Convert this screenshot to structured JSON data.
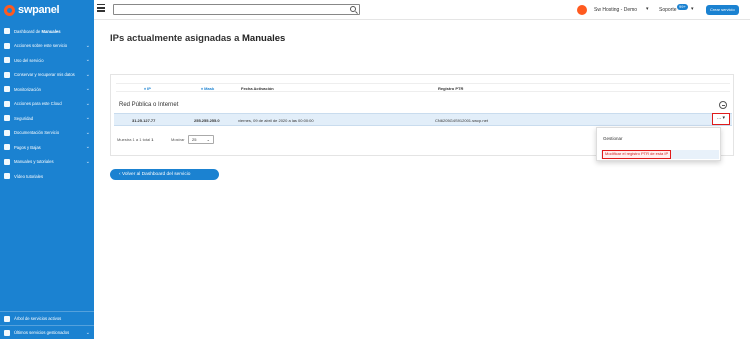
{
  "brand": {
    "logo_text": "swpanel",
    "accent": "#1b82d1",
    "logo_color": "#ff5a1f"
  },
  "sidebar": {
    "items": [
      {
        "label": "Dashboard de",
        "bold": "Manuales",
        "icon": "dashboard-icon"
      },
      {
        "label": "Acciones sobre este servicio",
        "icon": "gear-icon",
        "chevron": "⌄"
      },
      {
        "label": "Uso del servicio",
        "icon": "chart-icon",
        "chevron": "⌄"
      },
      {
        "label": "Conservar y recuperar mis datos",
        "icon": "backup-icon",
        "chevron": "⌄"
      },
      {
        "label": "Monitorización",
        "icon": "monitor-icon",
        "chevron": "⌄"
      },
      {
        "label": "Acciones para este Cloud",
        "icon": "cloud-icon",
        "chevron": "⌄"
      },
      {
        "label": "Seguridad",
        "icon": "shield-icon",
        "chevron": "⌄"
      },
      {
        "label": "Documentación Servicio",
        "icon": "document-icon",
        "chevron": "⌄"
      },
      {
        "label": "Pagos y Bajas",
        "icon": "wallet-icon",
        "chevron": "⌄"
      },
      {
        "label": "Manuales y tutoriales",
        "icon": "book-icon",
        "chevron": "⌄"
      },
      {
        "label": "Vídeo tutoriales",
        "icon": "video-icon"
      }
    ],
    "bottom": [
      {
        "label": "Árbol de servicios activos",
        "icon": "tree-icon"
      },
      {
        "label": "Últimos servicios gestionados",
        "icon": "list-icon",
        "chevron": "⌄"
      }
    ]
  },
  "topbar": {
    "brand_name": "Sw Hosting - Demo",
    "brand_caret": "▾",
    "support_label": "Soporte",
    "support_badge": "99+",
    "support_caret": "▾",
    "create_label": "Crear servicio"
  },
  "main": {
    "title_prefix": "IPs actualmente asignadas a",
    "title_bold": "Manuales",
    "columns": [
      "IP",
      "Mask",
      "Fecha Activación",
      "Registro PTR"
    ],
    "column_sort_marks": [
      "♦",
      "♦"
    ],
    "group_title": "Red Pública o Internet",
    "rows": [
      {
        "ip": "31.25.127.77",
        "mask": "255.255.255.0",
        "date": "viernes, 09 de abril de 2020 a las 00:00:00",
        "ptr": "CN6205G4S912001.swcp.net"
      }
    ],
    "row_action": "... ▾",
    "paging_text": "Muestra 1 a 1 total",
    "paging_total": "1",
    "show_label": "Mostrar",
    "show_value": "25",
    "back_label": "Volver al Dashboard del servicio"
  },
  "dropdown": {
    "items": [
      "Gestionar",
      "Modificar el registro PTR de esta IP"
    ]
  }
}
